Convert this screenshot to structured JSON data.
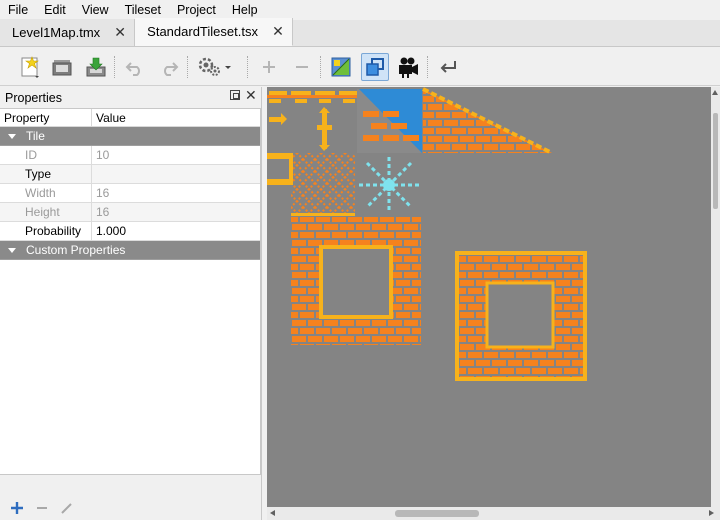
{
  "menubar": {
    "items": [
      "File",
      "Edit",
      "View",
      "Tileset",
      "Project",
      "Help"
    ]
  },
  "tabs": [
    {
      "label": "Level1Map.tmx",
      "active": false
    },
    {
      "label": "StandardTileset.tsx",
      "active": true
    }
  ],
  "toolbar": {
    "icons": [
      "new-file-icon",
      "open-folder-icon",
      "save-icon",
      "undo-icon",
      "redo-icon",
      "settings-icon",
      "add-tile-icon",
      "remove-tile-icon",
      "tileset-image-icon",
      "dynamic-wrap-icon",
      "animation-editor-icon",
      "back-icon"
    ]
  },
  "properties_panel": {
    "title": "Properties",
    "header": {
      "property": "Property",
      "value": "Value"
    },
    "groups": [
      {
        "name": "Tile",
        "rows": [
          {
            "name": "ID",
            "value": "10",
            "enabled": false
          },
          {
            "name": "Type",
            "value": "",
            "enabled": true
          },
          {
            "name": "Width",
            "value": "16",
            "enabled": false
          },
          {
            "name": "Height",
            "value": "16",
            "enabled": false
          },
          {
            "name": "Probability",
            "value": "1.000",
            "enabled": true
          }
        ]
      },
      {
        "name": "Custom Properties",
        "rows": []
      }
    ]
  },
  "colors": {
    "canvas_bg": "#848484",
    "tile_orange": "#f5821e",
    "tile_yellow": "#f7b21b",
    "tile_blue": "#2e8bd6",
    "tile_cyan": "#7fe3ee",
    "group_header": "#8a8a8a",
    "toolbar_checked": "#cfe3f7"
  }
}
